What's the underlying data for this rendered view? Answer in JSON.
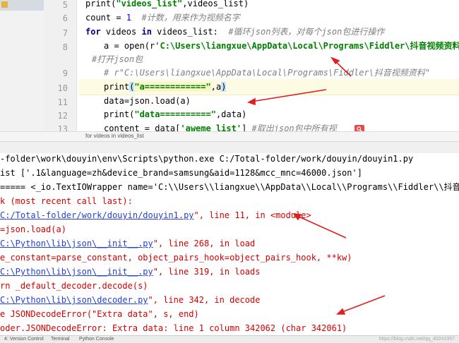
{
  "editor": {
    "line_numbers": [
      "5",
      "6",
      "7",
      "8",
      "",
      "9",
      "10",
      "11",
      "12",
      "13"
    ],
    "lines": {
      "l5": {
        "fn": "print(",
        "s": "\"videos_list\"",
        "rest": ",videos_list)"
      },
      "l6": {
        "a": "count = ",
        "num": "1",
        "cm": "  #计数，用来作为视频名字"
      },
      "l7": {
        "kw1": "for",
        "a": " videos ",
        "kw2": "in",
        "b": " videos_list:  ",
        "cm": "#循环json列表，对每个json包进行操作"
      },
      "l8": {
        "a": "a = open(r'",
        "s": "C:\\Users\\liangxue\\AppData\\Local\\Programs\\Fiddler\\抖音视频资料"
      },
      "l8b": {
        "cm": "#打开json包"
      },
      "l9": {
        "cm": "# r\"C:\\Users\\liangxue\\AppData\\Local\\Programs\\Fiddler\\抖音视频资料\""
      },
      "l10": {
        "a": "print",
        "p1": "(",
        "s": "\"a============\"",
        "b": ",a",
        "p2": ")"
      },
      "l11": {
        "a": "data=json.load(a)"
      },
      "l12": {
        "a": "print(",
        "s": "\"data==========\"",
        "b": ",data)"
      },
      "l13": {
        "a": "content = data[",
        "s": "'aweme_list'",
        "b": "] ",
        "cm": "#取出json包中所有视"
      }
    },
    "breadcrumb": "for videos in videos_list"
  },
  "console": {
    "l1": "-folder\\work\\douyin\\env\\Scripts\\python.exe C:/Total-folder/work/douyin/douyin1.py",
    "l2": "ist ['.1&language=zh&device_brand=samsung&aid=1128&mcc_mnc=46000.json']",
    "l3": "===== <_io.TextIOWrapper name='C:\\\\Users\\\\liangxue\\\\AppData\\\\Local\\\\Programs\\\\Fiddler\\\\抖音视频资料\\",
    "l4": "k (most recent call last):",
    "l5": {
      "link": "C:/Total-folder/work/douyin/douyin1.py",
      "rest": "\", line 11, in <module>"
    },
    "l6": "=json.load(a)",
    "l7": {
      "link": "C:\\Python\\lib\\json\\__init__.py",
      "rest": "\", line 268, in load"
    },
    "l8": "e_constant=parse_constant, object_pairs_hook=object_pairs_hook, **kw)",
    "l9": {
      "link": "C:\\Python\\lib\\json\\__init__.py",
      "rest": "\", line 319, in loads"
    },
    "l10": "rn _default_decoder.decode(s)",
    "l11": {
      "link": "C:\\Python\\lib\\json\\decoder.py",
      "rest": "\", line 342, in decode"
    },
    "l12": "e JSONDecodeError(\"Extra data\", s, end)",
    "l13": "oder.JSONDecodeError: Extra data: line 1 column 342062 (char 342061)"
  },
  "bottom_bar": {
    "t1": "4: Version Control",
    "t2": "Terminal",
    "t3": "Python Console",
    "watermark": "https://blog.csdn.net/qq_40241957"
  },
  "colors": {
    "annotation": "#e02020",
    "link": "#2541d6",
    "error": "#d40000"
  }
}
